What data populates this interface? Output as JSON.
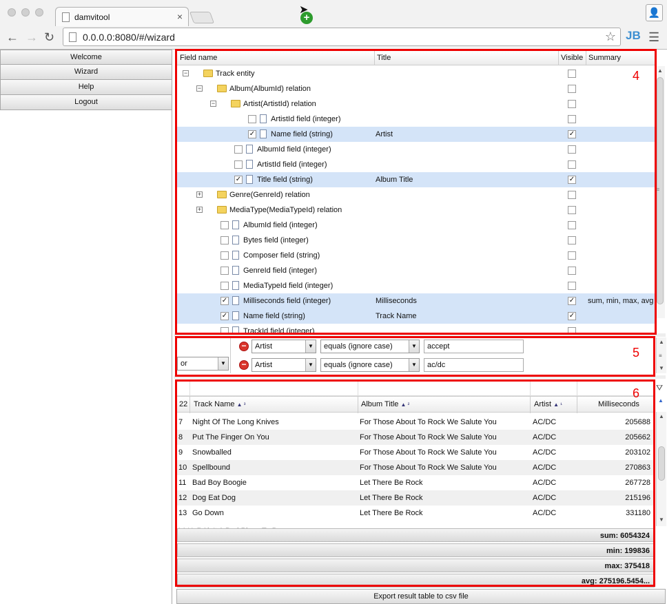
{
  "browser": {
    "tab_title": "damvitool",
    "tab_close": "×",
    "url": "0.0.0.0:8080/#/wizard",
    "ext_label": "JB"
  },
  "sidebar": {
    "items": [
      {
        "label": "Welcome"
      },
      {
        "label": "Wizard"
      },
      {
        "label": "Help"
      },
      {
        "label": "Logout"
      }
    ]
  },
  "tree": {
    "headers": {
      "field": "Field name",
      "title": "Title",
      "visible": "Visible",
      "summary": "Summary"
    },
    "rows": [
      {
        "name": "Track entity",
        "title": "",
        "visible": false,
        "summary": "",
        "selected": false,
        "checked": false,
        "type": "folder",
        "exp": "⊟"
      },
      {
        "name": "Album(AlbumId) relation",
        "title": "",
        "visible": false,
        "summary": "",
        "selected": false,
        "checked": false,
        "type": "folder",
        "exp": "⊟"
      },
      {
        "name": "Artist(ArtistId) relation",
        "title": "",
        "visible": false,
        "summary": "",
        "selected": false,
        "checked": false,
        "type": "folder",
        "exp": "⊟"
      },
      {
        "name": "ArtistId field (integer)",
        "title": "",
        "visible": false,
        "summary": "",
        "selected": false,
        "checked": false,
        "type": "field"
      },
      {
        "name": "Name field (string)",
        "title": "Artist",
        "visible": true,
        "summary": "",
        "selected": true,
        "checked": true,
        "type": "field"
      },
      {
        "name": "AlbumId field (integer)",
        "title": "",
        "visible": false,
        "summary": "",
        "selected": false,
        "checked": false,
        "type": "field"
      },
      {
        "name": "ArtistId field (integer)",
        "title": "",
        "visible": false,
        "summary": "",
        "selected": false,
        "checked": false,
        "type": "field"
      },
      {
        "name": "Title field (string)",
        "title": "Album Title",
        "visible": true,
        "summary": "",
        "selected": true,
        "checked": true,
        "type": "field"
      },
      {
        "name": "Genre(GenreId) relation",
        "title": "",
        "visible": false,
        "summary": "",
        "selected": false,
        "checked": false,
        "type": "folder",
        "exp": "⊞"
      },
      {
        "name": "MediaType(MediaTypeId) relation",
        "title": "",
        "visible": false,
        "summary": "",
        "selected": false,
        "checked": false,
        "type": "folder",
        "exp": "⊞"
      },
      {
        "name": "AlbumId field (integer)",
        "title": "",
        "visible": false,
        "summary": "",
        "selected": false,
        "checked": false,
        "type": "field"
      },
      {
        "name": "Bytes field (integer)",
        "title": "",
        "visible": false,
        "summary": "",
        "selected": false,
        "checked": false,
        "type": "field"
      },
      {
        "name": "Composer field (string)",
        "title": "",
        "visible": false,
        "summary": "",
        "selected": false,
        "checked": false,
        "type": "field"
      },
      {
        "name": "GenreId field (integer)",
        "title": "",
        "visible": false,
        "summary": "",
        "selected": false,
        "checked": false,
        "type": "field"
      },
      {
        "name": "MediaTypeId field (integer)",
        "title": "",
        "visible": false,
        "summary": "",
        "selected": false,
        "checked": false,
        "type": "field"
      },
      {
        "name": "Milliseconds field (integer)",
        "title": "Milliseconds",
        "visible": true,
        "summary": "sum, min, max, avg",
        "selected": true,
        "checked": true,
        "type": "field"
      },
      {
        "name": "Name field (string)",
        "title": "Track Name",
        "visible": true,
        "summary": "",
        "selected": true,
        "checked": true,
        "type": "field"
      },
      {
        "name": "TrackId field (integer)",
        "title": "",
        "visible": false,
        "summary": "",
        "selected": false,
        "checked": false,
        "type": "field"
      }
    ]
  },
  "filters": {
    "logic": "or",
    "conditions": [
      {
        "field": "Artist",
        "op": "equals (ignore case)",
        "value": "accept"
      },
      {
        "field": "Artist",
        "op": "equals (ignore case)",
        "value": "ac/dc"
      }
    ]
  },
  "results": {
    "count": "22",
    "columns": [
      {
        "label": "Track Name",
        "sort": "▲ ³"
      },
      {
        "label": "Album Title",
        "sort": "▲ ²"
      },
      {
        "label": "Artist",
        "sort": "▲ ¹"
      },
      {
        "label": "Milliseconds",
        "sort": ""
      }
    ],
    "rows": [
      {
        "n": "7",
        "track": "Night Of The Long Knives",
        "album": "For Those About To Rock We Salute You",
        "artist": "AC/DC",
        "ms": "205688"
      },
      {
        "n": "8",
        "track": "Put The Finger On You",
        "album": "For Those About To Rock We Salute You",
        "artist": "AC/DC",
        "ms": "205662"
      },
      {
        "n": "9",
        "track": "Snowballed",
        "album": "For Those About To Rock We Salute You",
        "artist": "AC/DC",
        "ms": "203102"
      },
      {
        "n": "10",
        "track": "Spellbound",
        "album": "For Those About To Rock We Salute You",
        "artist": "AC/DC",
        "ms": "270863"
      },
      {
        "n": "11",
        "track": "Bad Boy Boogie",
        "album": "Let There Be Rock",
        "artist": "AC/DC",
        "ms": "267728"
      },
      {
        "n": "12",
        "track": "Dog Eat Dog",
        "album": "Let There Be Rock",
        "artist": "AC/DC",
        "ms": "215196"
      },
      {
        "n": "13",
        "track": "Go Down",
        "album": "Let There Be Rock",
        "artist": "AC/DC",
        "ms": "331180"
      }
    ],
    "aggregates": {
      "sum": "sum: 6054324",
      "min": "min: 199836",
      "max": "max: 375418",
      "avg": "avg: 275196.5454..."
    }
  },
  "annotations": {
    "n4": "4",
    "n5": "5",
    "n6": "6"
  },
  "export_label": "Export result table to csv file",
  "colors": {
    "highlight": "#e00000",
    "selected_row": "#d4e4f8"
  }
}
